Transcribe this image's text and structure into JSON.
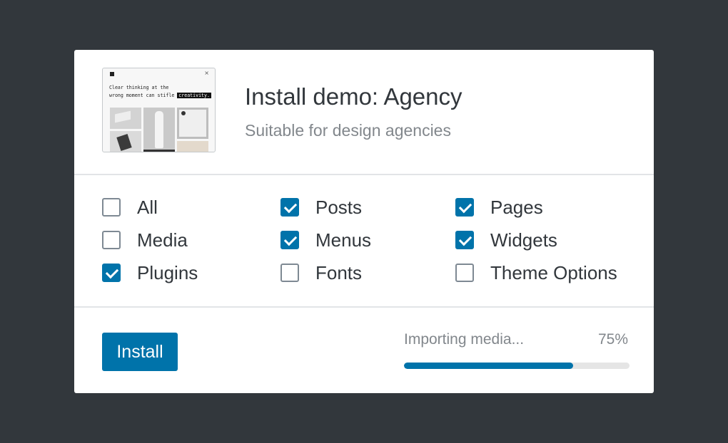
{
  "demo": {
    "title": "Install demo: Agency",
    "subtitle": "Suitable for design agencies",
    "preview": {
      "close_glyph": "×",
      "text_line1": "Clear thinking at the",
      "text_line2": "wrong moment can stifle",
      "highlight": "creativity."
    }
  },
  "options": [
    {
      "label": "All",
      "checked": false
    },
    {
      "label": "Posts",
      "checked": true
    },
    {
      "label": "Pages",
      "checked": true
    },
    {
      "label": "Media",
      "checked": false
    },
    {
      "label": "Menus",
      "checked": true
    },
    {
      "label": "Widgets",
      "checked": true
    },
    {
      "label": "Plugins",
      "checked": true
    },
    {
      "label": "Fonts",
      "checked": false
    },
    {
      "label": "Theme Options",
      "checked": false
    }
  ],
  "footer": {
    "install_label": "Install",
    "status_text": "Importing media...",
    "percent_text": "75%",
    "progress": 0.75
  },
  "colors": {
    "accent": "#0073aa",
    "background": "#32373c",
    "text_primary": "#32373c",
    "text_muted": "#82878c"
  }
}
